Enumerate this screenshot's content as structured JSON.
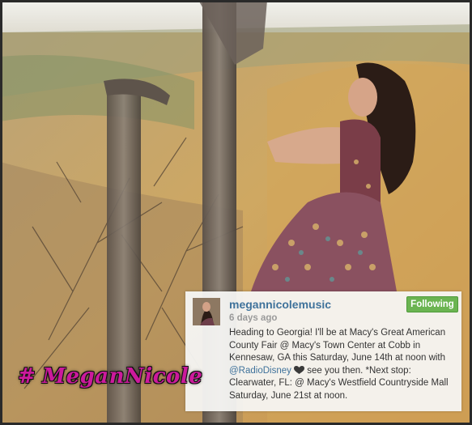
{
  "post": {
    "username": "megannicolemusic",
    "timestamp": "6 days ago",
    "follow_label": "Following",
    "caption": {
      "part1": "Heading to Georgia! I'll be at Macy's Great American County Fair @ Macy's Town Center at Cobb in Kennesaw, GA this Saturday, June 14th at noon with ",
      "mention": "@RadioDisney",
      "part2": " see you then. *Next stop: Clearwater, FL: @ Macy's Westfield Countryside Mall Saturday, June 21st at noon."
    }
  },
  "overlay": {
    "hash": "#",
    "name": "MeganNicole"
  },
  "colors": {
    "username": "#3f729b",
    "following_button": "#6bb451",
    "hashtag": "#cc1a9c"
  },
  "icons": {
    "heart": "heart-icon",
    "avatar": "avatar"
  }
}
